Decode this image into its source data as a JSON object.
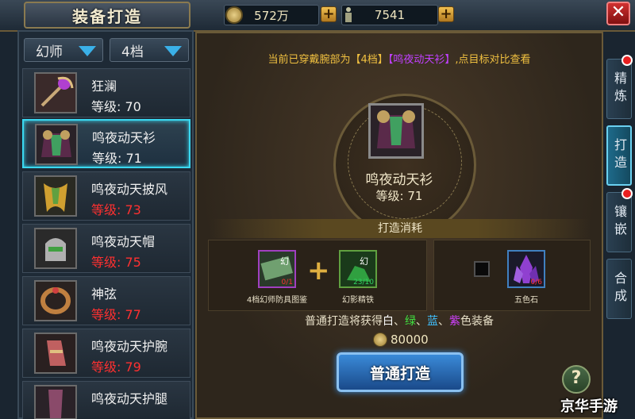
{
  "header": {
    "title": "装备打造"
  },
  "resources": {
    "gold": "572万",
    "ingots": "7541"
  },
  "filters": {
    "class": "幻师",
    "tier": "4档"
  },
  "items": [
    {
      "name": "狂澜",
      "level": "等级: 70",
      "level_ok": true
    },
    {
      "name": "鸣夜动天衫",
      "level": "等级: 71",
      "level_ok": true
    },
    {
      "name": "鸣夜动天披风",
      "level": "等级: 73",
      "level_ok": false
    },
    {
      "name": "鸣夜动天帽",
      "level": "等级: 75",
      "level_ok": false
    },
    {
      "name": "神弦",
      "level": "等级: 77",
      "level_ok": false
    },
    {
      "name": "鸣夜动天护腕",
      "level": "等级: 79",
      "level_ok": false
    },
    {
      "name": "鸣夜动天护腿",
      "level": "",
      "level_ok": false
    }
  ],
  "hint": {
    "prefix": "当前已穿戴腕部为【4档】",
    "equipped": "【鸣夜动天衫】",
    "suffix": ",点目标对比查看"
  },
  "selected": {
    "name": "鸣夜动天衫",
    "level": "等级: 71"
  },
  "cost_title": "打造消耗",
  "materials": [
    {
      "label": "4档幻师防具图鉴",
      "count": "0/1",
      "enough": false
    },
    {
      "label": "幻影精铁",
      "count": "23/10",
      "enough": true
    },
    {
      "label": "五色石",
      "count": "0/6",
      "enough": false
    }
  ],
  "gain": {
    "prefix": "普通打造将获得",
    "white": "白",
    "sep1": "、",
    "green": "绿",
    "sep2": "、",
    "blue": "蓝",
    "sep3": "、",
    "purple": "紫",
    "suffix": "色装备"
  },
  "price": "80000",
  "forge_button": "普通打造",
  "help_label": "?",
  "tabs": [
    {
      "label": "精炼",
      "active": false,
      "dot": true
    },
    {
      "label": "打造",
      "active": true,
      "dot": false
    },
    {
      "label": "镶嵌",
      "active": false,
      "dot": true
    },
    {
      "label": "合成",
      "active": false,
      "dot": false
    }
  ],
  "watermark": "京华手游",
  "colors": {
    "accent": "#3ad8f0",
    "gold_text": "#f0c040",
    "red": "#ff3030"
  },
  "icons": {
    "gold": "coin-icon",
    "ingot": "figure-icon",
    "close": "close-icon",
    "help": "help-icon"
  }
}
